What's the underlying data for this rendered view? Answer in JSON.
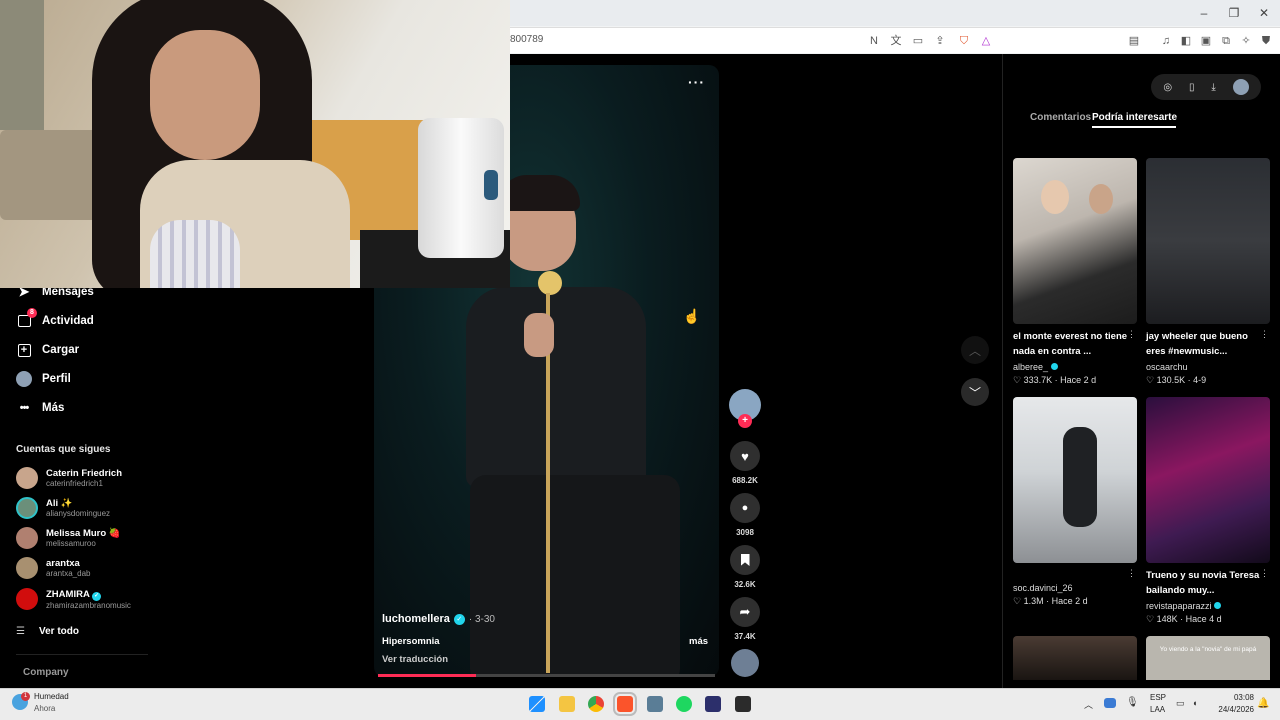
{
  "browser": {
    "url_fragment": "800789",
    "window_controls": {
      "minimize": "–",
      "restore": "❐",
      "close": "✕"
    }
  },
  "sidebar": {
    "nav": [
      {
        "label": "Mensajes",
        "icon": "paper-plane-icon"
      },
      {
        "label": "Actividad",
        "icon": "activity-icon",
        "badge": "8"
      },
      {
        "label": "Cargar",
        "icon": "upload-icon"
      },
      {
        "label": "Perfil",
        "icon": "profile-avatar-icon"
      },
      {
        "label": "Más",
        "icon": "more-dots-icon"
      }
    ],
    "following_title": "Cuentas que sigues",
    "following": [
      {
        "name": "Caterin Friedrich",
        "handle": "caterinfriedrich1",
        "color": "#c8a58c"
      },
      {
        "name": "Ali ✨",
        "handle": "alianysdominguez",
        "color": "#6b8f7a"
      },
      {
        "name": "Melissa Muro 🍓",
        "handle": "melissamuroo",
        "color": "#b08070"
      },
      {
        "name": "arantxa",
        "handle": "arantxa_dab",
        "color": "#a89070"
      },
      {
        "name": "ZHAMIRA",
        "handle": "zhamirazambranomusic",
        "color": "#d10d0d"
      }
    ],
    "see_all": "Ver todo",
    "footer": "Company"
  },
  "video": {
    "author": "luchomellera",
    "date": "· 3-30",
    "caption": "Hipersomnia",
    "translate": "Ver traducción",
    "more": "más",
    "menu": "···",
    "progress": 0.29,
    "likes": "688.2K",
    "comments": "3098",
    "saves": "32.6K",
    "shares": "37.4K",
    "accent": "#fe2c55"
  },
  "right_panel": {
    "tabs": [
      "Comentarios",
      "Podría interesarte"
    ],
    "active_tab": 1,
    "items": [
      {
        "title": "el monte everest no tiene nada en contra ...",
        "author": "alberee_",
        "verified": true,
        "stats": "♡ 333.7K · Hace 2 d"
      },
      {
        "title": "jay wheeler que bueno eres #newmusic...",
        "author": "oscaarchu",
        "verified": false,
        "stats": "♡ 130.5K · 4-9"
      },
      {
        "title": "",
        "author": "soc.davinci_26",
        "verified": false,
        "stats": "♡ 1.3M · Hace 2 d"
      },
      {
        "title": "Trueno y su novia Teresa bailando muy...",
        "author": "revistapaparazzi",
        "verified": true,
        "stats": "♡ 148K · Hace 4 d"
      }
    ],
    "thumb_overlay_text": "Yo viendo a la \"novia\" de mi papá"
  },
  "taskbar": {
    "weather_title": "Humedad",
    "weather_sub": "Ahora",
    "lang_top": "ESP",
    "lang_bottom": "LAA",
    "time": "03:08",
    "date": "24/4/2026",
    "notification_badge": "1"
  }
}
